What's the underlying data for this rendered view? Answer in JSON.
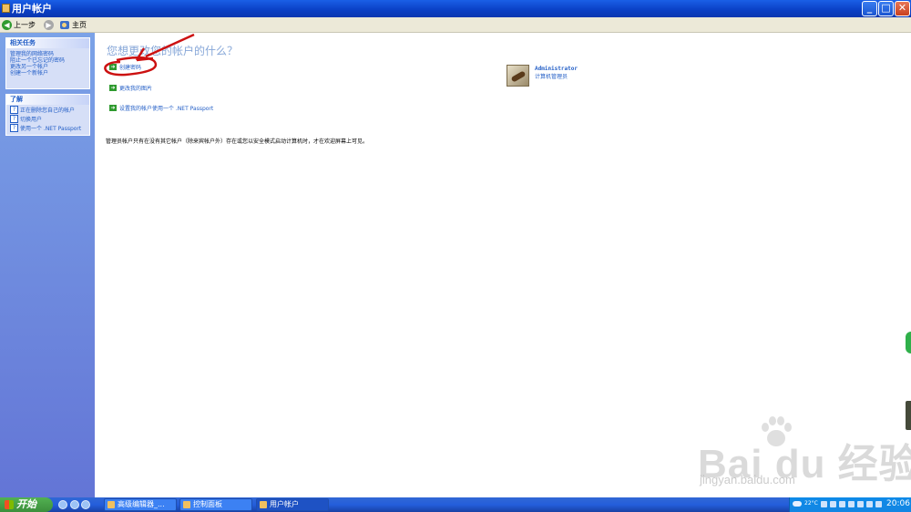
{
  "window": {
    "title": "用户帐户",
    "controls": {
      "minimize": "_",
      "maximize": "□",
      "close": "✕"
    }
  },
  "toolbar": {
    "back": "上一步",
    "home": "主页"
  },
  "sidebar": {
    "related": {
      "header": "相关任务",
      "items": [
        "管理我的网络密码",
        "阻止一个已忘记的密码",
        "更改另一个帐户",
        "创建一个新帐户"
      ]
    },
    "learn": {
      "header": "了解",
      "items": [
        "正在删除您自己的帐户",
        "切换用户",
        "使用一个 .NET Passport"
      ]
    }
  },
  "main": {
    "heading": "您想更改您的帐户的什么？",
    "tasks": [
      "创建密码",
      "更改我的图片",
      "设置我的帐户使用一个 .NET Passport"
    ],
    "note": "管理员帐户只有在没有其它帐户（除来宾帐户外）存在或您以安全模式启动计算机时，才在欢迎屏幕上可见。",
    "user": {
      "name": "Administrator",
      "role": "计算机管理员"
    }
  },
  "watermark": {
    "brand": "Bai du 经验",
    "url": "jingyan.baidu.com"
  },
  "taskbar": {
    "start": "开始",
    "buttons": [
      "高级编辑器_...",
      "控制面板",
      "用户帐户"
    ],
    "tray": {
      "temperature": "22°C",
      "time": "20:06"
    }
  },
  "colors": {
    "accent": "#215dc6",
    "annotation": "#cc1111",
    "title_bar": "#0a3fc4"
  }
}
